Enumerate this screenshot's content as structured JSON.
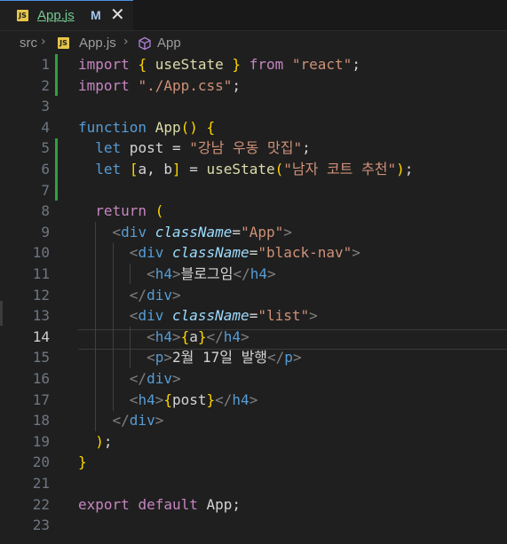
{
  "tab": {
    "file_icon": "JS",
    "label": "App.js",
    "modified": "M",
    "close": "✕"
  },
  "breadcrumb": {
    "folder": "src",
    "file_icon": "JS",
    "file": "App.js",
    "symbol": "App"
  },
  "editor": {
    "active_line": 14,
    "line_numbers": [
      "1",
      "2",
      "3",
      "4",
      "5",
      "6",
      "7",
      "8",
      "9",
      "10",
      "11",
      "12",
      "13",
      "14",
      "15",
      "16",
      "17",
      "18",
      "19",
      "20",
      "21",
      "22",
      "23"
    ],
    "lines": [
      "import { useState } from \"react\";",
      "import \"./App.css\";",
      "",
      "function App() {",
      "  let post = \"강남 우동 맛집\";",
      "  let [a, b] = useState(\"남자 코트 추천\");",
      "",
      "  return (",
      "    <div className=\"App\">",
      "      <div className=\"black-nav\">",
      "        <h4>블로그임</h4>",
      "      </div>",
      "      <div className=\"list\">",
      "        <h4>{a}</h4>",
      "        <p>2월 17일 발행</p>",
      "      </div>",
      "      <h4>{post}</h4>",
      "    </div>",
      "  );",
      "}",
      "",
      "export default App;",
      ""
    ]
  }
}
